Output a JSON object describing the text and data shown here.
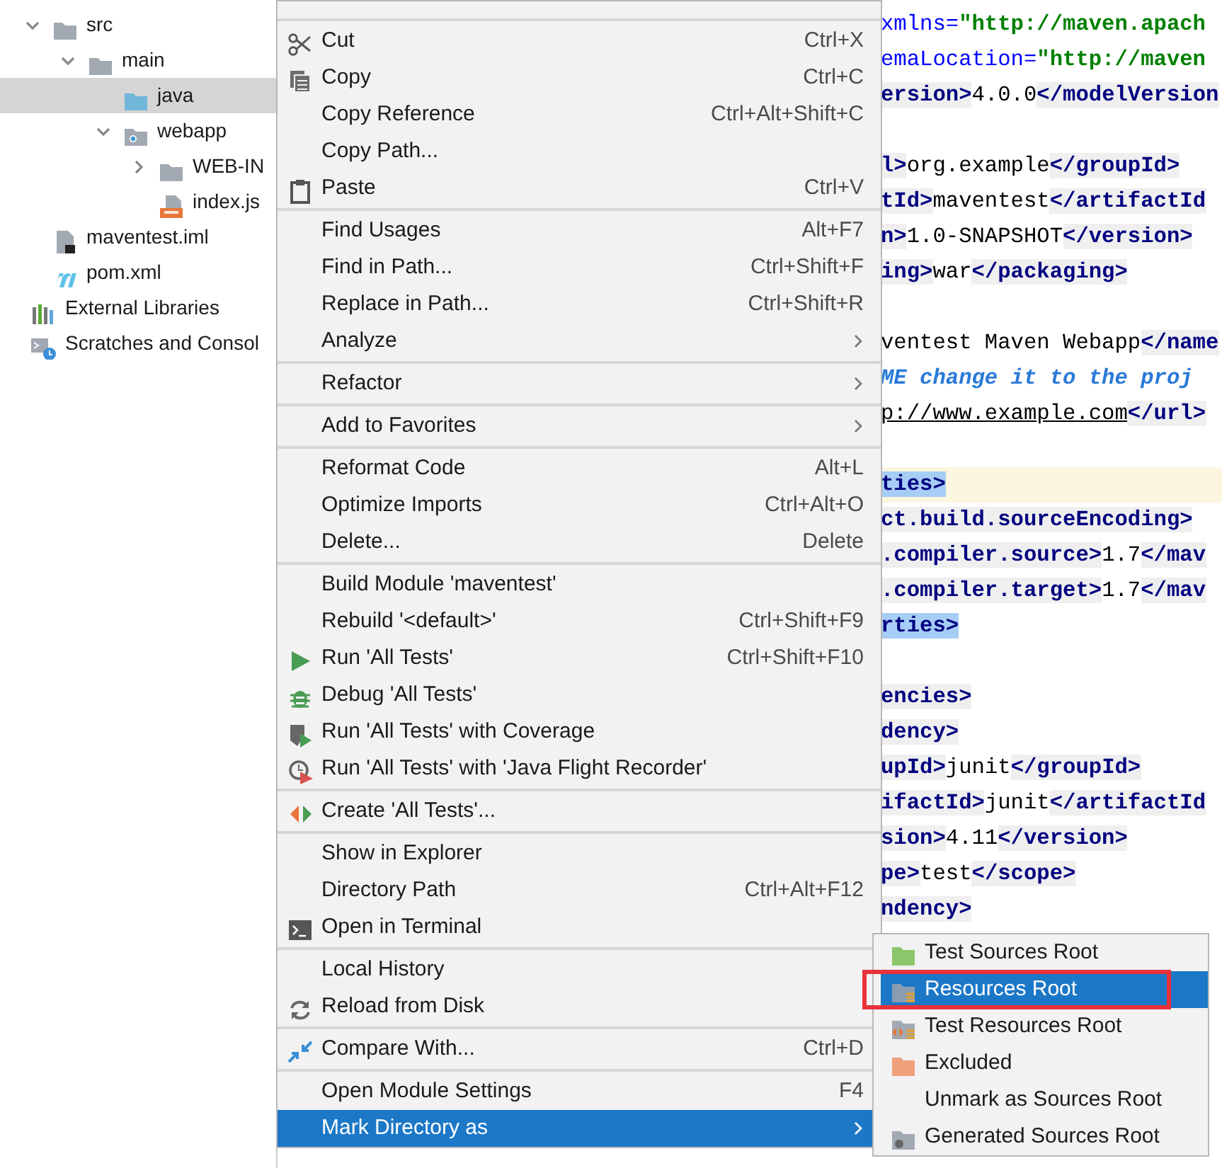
{
  "project_tree": {
    "project_children": [
      {
        "label": "src",
        "kind": "folder",
        "expanded": true,
        "selected": false,
        "children": [
          {
            "label": "main",
            "kind": "folder",
            "expanded": true,
            "selected": false,
            "children": [
              {
                "label": "java",
                "kind": "source-folder",
                "selected": true
              },
              {
                "label": "webapp",
                "kind": "web-folder",
                "expanded": true,
                "selected": false,
                "children": [
                  {
                    "label": "WEB-IN",
                    "kind": "folder",
                    "expanded": false,
                    "selected": false
                  },
                  {
                    "label": "index.js",
                    "kind": "jsp",
                    "selected": false
                  }
                ]
              }
            ]
          }
        ]
      },
      {
        "label": "maventest.iml",
        "kind": "iml",
        "selected": false
      },
      {
        "label": "pom.xml",
        "kind": "maven",
        "selected": false
      }
    ],
    "roots": [
      {
        "label": "External Libraries",
        "kind": "libraries",
        "selected": false
      },
      {
        "label": "Scratches and Consol",
        "kind": "scratches",
        "selected": false
      }
    ]
  },
  "editor": {
    "lines": [
      {
        "kind": "code",
        "segs": [
          {
            "text": "xmlns=",
            "kind": "attr"
          },
          {
            "text": "\"http://maven.apach",
            "kind": "str"
          }
        ]
      },
      {
        "kind": "code",
        "segs": [
          {
            "text": "emaLocation=",
            "kind": "attr"
          },
          {
            "text": "\"http://maven",
            "kind": "str"
          }
        ]
      },
      {
        "kind": "code",
        "segs": [
          {
            "text": "ersion>",
            "kind": "tag"
          },
          {
            "text": "4.0.0",
            "kind": "text"
          },
          {
            "text": "</modelVersion",
            "kind": "tag"
          }
        ]
      },
      {
        "kind": "blank"
      },
      {
        "kind": "code",
        "segs": [
          {
            "text": "l>",
            "kind": "tag"
          },
          {
            "text": "org.example",
            "kind": "text"
          },
          {
            "text": "</groupId>",
            "kind": "tag"
          }
        ]
      },
      {
        "kind": "code",
        "segs": [
          {
            "text": "tId>",
            "kind": "tag"
          },
          {
            "text": "maventest",
            "kind": "text"
          },
          {
            "text": "</artifactId",
            "kind": "tag"
          }
        ]
      },
      {
        "kind": "code",
        "segs": [
          {
            "text": "n>",
            "kind": "tag"
          },
          {
            "text": "1.0-SNAPSHOT",
            "kind": "text"
          },
          {
            "text": "</version>",
            "kind": "tag"
          }
        ]
      },
      {
        "kind": "code",
        "segs": [
          {
            "text": "ing>",
            "kind": "tag"
          },
          {
            "text": "war",
            "kind": "text"
          },
          {
            "text": "</packaging>",
            "kind": "tag"
          }
        ]
      },
      {
        "kind": "blank"
      },
      {
        "kind": "code",
        "segs": [
          {
            "text": "ventest Maven Webapp",
            "kind": "text"
          },
          {
            "text": "</name",
            "kind": "tag"
          }
        ]
      },
      {
        "kind": "code",
        "segs": [
          {
            "text": "ME change it to the proj",
            "kind": "comment"
          }
        ]
      },
      {
        "kind": "code",
        "segs": [
          {
            "text": "p://www.example.com",
            "kind": "link"
          },
          {
            "text": "</url>",
            "kind": "tag"
          }
        ]
      },
      {
        "kind": "blank"
      },
      {
        "kind": "code",
        "caret": true,
        "segs": [
          {
            "text": "ties>",
            "kind": "match"
          }
        ]
      },
      {
        "kind": "code",
        "segs": [
          {
            "text": "ct.build.sourceEncoding>",
            "kind": "tag"
          }
        ]
      },
      {
        "kind": "code",
        "segs": [
          {
            "text": ".compiler.source>",
            "kind": "tag"
          },
          {
            "text": "1.7",
            "kind": "text"
          },
          {
            "text": "</mav",
            "kind": "tag"
          }
        ]
      },
      {
        "kind": "code",
        "segs": [
          {
            "text": ".compiler.target>",
            "kind": "tag"
          },
          {
            "text": "1.7",
            "kind": "text"
          },
          {
            "text": "</mav",
            "kind": "tag"
          }
        ]
      },
      {
        "kind": "code",
        "segs": [
          {
            "text": "rties>",
            "kind": "match"
          }
        ]
      },
      {
        "kind": "blank"
      },
      {
        "kind": "code",
        "segs": [
          {
            "text": "encies>",
            "kind": "tag"
          }
        ]
      },
      {
        "kind": "code",
        "segs": [
          {
            "text": "dency>",
            "kind": "tag"
          }
        ]
      },
      {
        "kind": "code",
        "segs": [
          {
            "text": "upId>",
            "kind": "tag"
          },
          {
            "text": "junit",
            "kind": "text"
          },
          {
            "text": "</groupId>",
            "kind": "tag"
          }
        ]
      },
      {
        "kind": "code",
        "segs": [
          {
            "text": "ifactId>",
            "kind": "tag"
          },
          {
            "text": "junit",
            "kind": "text"
          },
          {
            "text": "</artifactId",
            "kind": "tag"
          }
        ]
      },
      {
        "kind": "code",
        "segs": [
          {
            "text": "sion>",
            "kind": "tag"
          },
          {
            "text": "4.11",
            "kind": "text"
          },
          {
            "text": "</version>",
            "kind": "tag"
          }
        ]
      },
      {
        "kind": "code",
        "segs": [
          {
            "text": "pe>",
            "kind": "tag"
          },
          {
            "text": "test",
            "kind": "text"
          },
          {
            "text": "</scope>",
            "kind": "tag"
          }
        ]
      },
      {
        "kind": "code",
        "segs": [
          {
            "text": "ndency>",
            "kind": "tag"
          }
        ]
      }
    ]
  },
  "context_menu": {
    "items": [
      {
        "kind": "separator"
      },
      {
        "kind": "cut",
        "label": "Cut",
        "shortcut": "Ctrl+X",
        "selected": false
      },
      {
        "kind": "copy",
        "label": "Copy",
        "shortcut": "Ctrl+C",
        "selected": false
      },
      {
        "kind": "plain",
        "label": "Copy Reference",
        "shortcut": "Ctrl+Alt+Shift+C",
        "selected": false
      },
      {
        "kind": "plain",
        "label": "Copy Path...",
        "selected": false
      },
      {
        "kind": "paste",
        "label": "Paste",
        "shortcut": "Ctrl+V",
        "selected": false
      },
      {
        "kind": "separator"
      },
      {
        "kind": "plain",
        "label": "Find Usages",
        "shortcut": "Alt+F7",
        "selected": false
      },
      {
        "kind": "plain",
        "label": "Find in Path...",
        "shortcut": "Ctrl+Shift+F",
        "selected": false
      },
      {
        "kind": "plain",
        "label": "Replace in Path...",
        "shortcut": "Ctrl+Shift+R",
        "selected": false
      },
      {
        "kind": "plain",
        "label": "Analyze",
        "submenu": true,
        "selected": false
      },
      {
        "kind": "separator"
      },
      {
        "kind": "plain",
        "label": "Refactor",
        "submenu": true,
        "selected": false
      },
      {
        "kind": "separator"
      },
      {
        "kind": "plain",
        "label": "Add to Favorites",
        "submenu": true,
        "selected": false
      },
      {
        "kind": "separator"
      },
      {
        "kind": "plain",
        "label": "Reformat Code",
        "shortcut": "Alt+L",
        "selected": false
      },
      {
        "kind": "plain",
        "label": "Optimize Imports",
        "shortcut": "Ctrl+Alt+O",
        "selected": false
      },
      {
        "kind": "plain",
        "label": "Delete...",
        "shortcut": "Delete",
        "selected": false
      },
      {
        "kind": "separator"
      },
      {
        "kind": "plain",
        "label": "Build Module 'maventest'",
        "selected": false
      },
      {
        "kind": "plain",
        "label": "Rebuild '<default>'",
        "shortcut": "Ctrl+Shift+F9",
        "selected": false
      },
      {
        "kind": "run",
        "label": "Run 'All Tests'",
        "shortcut": "Ctrl+Shift+F10",
        "selected": false
      },
      {
        "kind": "debug",
        "label": "Debug 'All Tests'",
        "selected": false
      },
      {
        "kind": "coverage",
        "label": "Run 'All Tests' with Coverage",
        "selected": false
      },
      {
        "kind": "profiler",
        "label": "Run 'All Tests' with 'Java Flight Recorder'",
        "selected": false
      },
      {
        "kind": "separator"
      },
      {
        "kind": "create-test",
        "label": "Create 'All Tests'...",
        "selected": false
      },
      {
        "kind": "separator"
      },
      {
        "kind": "plain",
        "label": "Show in Explorer",
        "selected": false
      },
      {
        "kind": "plain",
        "label": "Directory Path",
        "shortcut": "Ctrl+Alt+F12",
        "selected": false
      },
      {
        "kind": "terminal",
        "label": "Open in Terminal",
        "selected": false
      },
      {
        "kind": "separator"
      },
      {
        "kind": "plain",
        "label": "Local History",
        "selected": false
      },
      {
        "kind": "reload",
        "label": "Reload from Disk",
        "selected": false
      },
      {
        "kind": "separator"
      },
      {
        "kind": "compare",
        "label": "Compare With...",
        "shortcut": "Ctrl+D",
        "selected": false
      },
      {
        "kind": "separator"
      },
      {
        "kind": "plain",
        "label": "Open Module Settings",
        "shortcut": "F4",
        "selected": false
      },
      {
        "kind": "plain",
        "label": "Mark Directory as",
        "submenu": true,
        "selected": true
      }
    ]
  },
  "submenu": {
    "items": [
      {
        "kind": "test-sources",
        "label": "Test Sources Root",
        "selected": false,
        "annotated": false
      },
      {
        "kind": "resources",
        "label": "Resources Root",
        "selected": true,
        "annotated": true
      },
      {
        "kind": "test-resources",
        "label": "Test Resources Root",
        "selected": false,
        "annotated": false
      },
      {
        "kind": "excluded",
        "label": "Excluded",
        "selected": false,
        "annotated": false
      },
      {
        "kind": "plain",
        "label": "Unmark as Sources Root",
        "selected": false,
        "annotated": false
      },
      {
        "kind": "generated",
        "label": "Generated Sources Root",
        "selected": false,
        "annotated": false
      }
    ]
  }
}
